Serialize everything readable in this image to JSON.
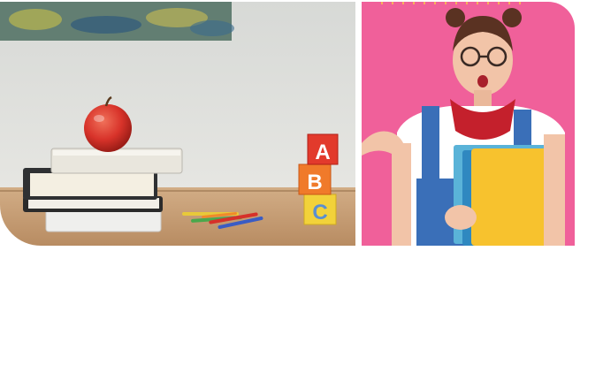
{
  "gallery": {
    "images": [
      {
        "subject": "apple-on-books-with-abc-blocks",
        "colors": {
          "wall": "#dcdedb",
          "desk": "#c8a27a",
          "apple": "#d8332a",
          "block_red": "#e23a2c",
          "block_orange": "#f07a2a",
          "block_yellow": "#f2d23a"
        },
        "block_letters": [
          "A",
          "B",
          "C"
        ]
      },
      {
        "subject": "student-with-yellow-folders",
        "colors": {
          "background": "#f0609a",
          "overalls": "#3a6fb8",
          "bandana": "#c4202c",
          "folder_yellow": "#f7c22e",
          "shirt": "#ffffff"
        }
      }
    ]
  }
}
